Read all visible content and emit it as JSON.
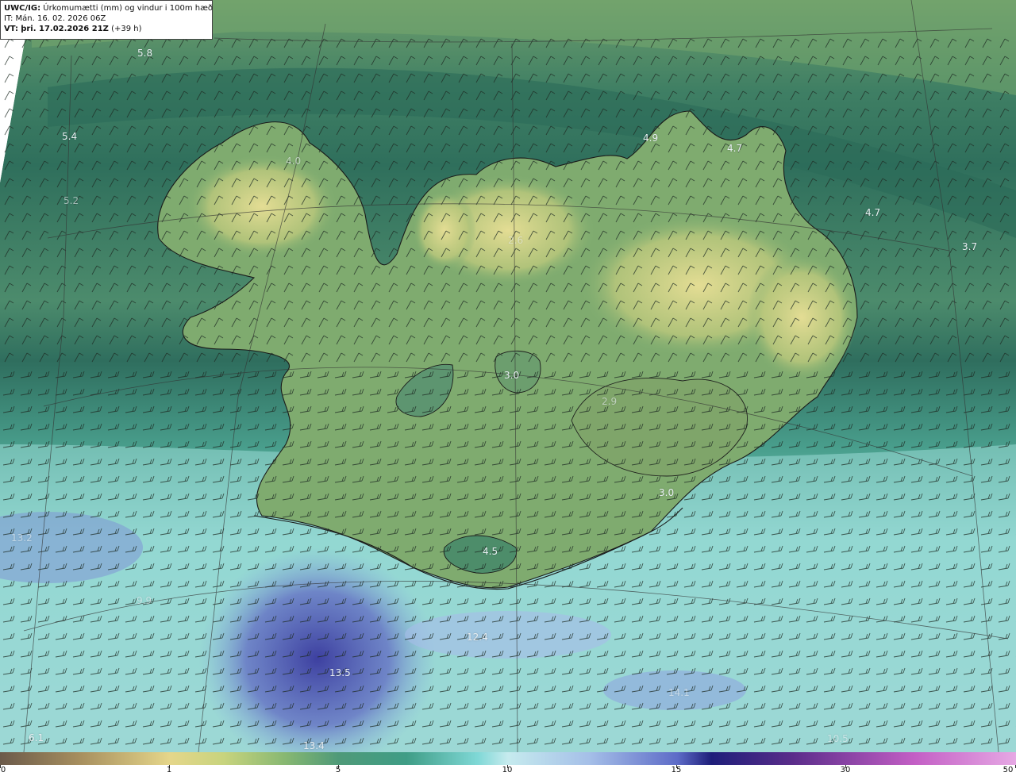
{
  "header": {
    "product": "UWC/IG:",
    "title": "Úrkomumætti (mm) og vindur i 100m hæð",
    "initial_time": "IT: Mán. 16. 02. 2026 06Z",
    "valid_prefix": "VT:",
    "valid_time": "þri. 17.02.2026 21Z",
    "lead": "(+39 h)"
  },
  "point_values": [
    "5.8",
    "5.4",
    "5.2",
    "4.9",
    "4.7",
    "4.7",
    "3.7",
    "3.0",
    "2.9",
    "3.0",
    "4.5",
    "13.2",
    "9.9",
    "12.4",
    "13.5",
    "13.4",
    "6.1",
    "14.1",
    "10.5",
    "4.0",
    "2.6"
  ],
  "colorbar": {
    "ticks": [
      "0",
      "1",
      "5",
      "10",
      "15",
      "30",
      "50"
    ]
  },
  "colors": {
    "moist_dark": "#2f6b5a",
    "mid_green": "#5b9a6e",
    "land_yellow": "#d8d58a",
    "cyan": "#8cd6cf",
    "blue": "#6470c4",
    "deep_blue": "#3b3f9a"
  }
}
